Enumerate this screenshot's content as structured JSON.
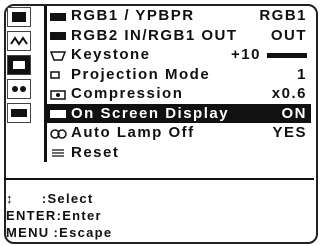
{
  "tabs": [
    {
      "icon": "picture-icon",
      "selected": false
    },
    {
      "icon": "signal-icon",
      "selected": false
    },
    {
      "icon": "options-icon",
      "selected": true
    },
    {
      "icon": "network-icon",
      "selected": false
    },
    {
      "icon": "language-icon",
      "selected": false
    }
  ],
  "menu": [
    {
      "icon": "input-ypbpr-icon",
      "label": "RGB1 / YPBPR",
      "value": "RGB1",
      "selected": false
    },
    {
      "icon": "input-rgb2-icon",
      "label": "RGB2  IN/RGB1  OUT",
      "value": "OUT",
      "selected": false
    },
    {
      "icon": "keystone-icon",
      "label": "Keystone",
      "value": "+10",
      "selected": false
    },
    {
      "icon": "projection-mode-icon",
      "label": "Projection Mode",
      "value": "1",
      "selected": false
    },
    {
      "icon": "compression-icon",
      "label": "Compression",
      "value": "x0.6",
      "selected": false
    },
    {
      "icon": "on-screen-display-icon",
      "label": "On Screen Display",
      "value": "ON",
      "selected": true
    },
    {
      "icon": "auto-lamp-off-icon",
      "label": "Auto Lamp Off",
      "value": "YES",
      "selected": false
    },
    {
      "icon": "reset-icon",
      "label": "Reset",
      "value": "",
      "selected": false
    }
  ],
  "hints": [
    {
      "key": "↕",
      "text": ":Select"
    },
    {
      "key": "ENTER",
      "text": ":Enter"
    },
    {
      "key": "MENU",
      "text": ":Escape"
    }
  ]
}
